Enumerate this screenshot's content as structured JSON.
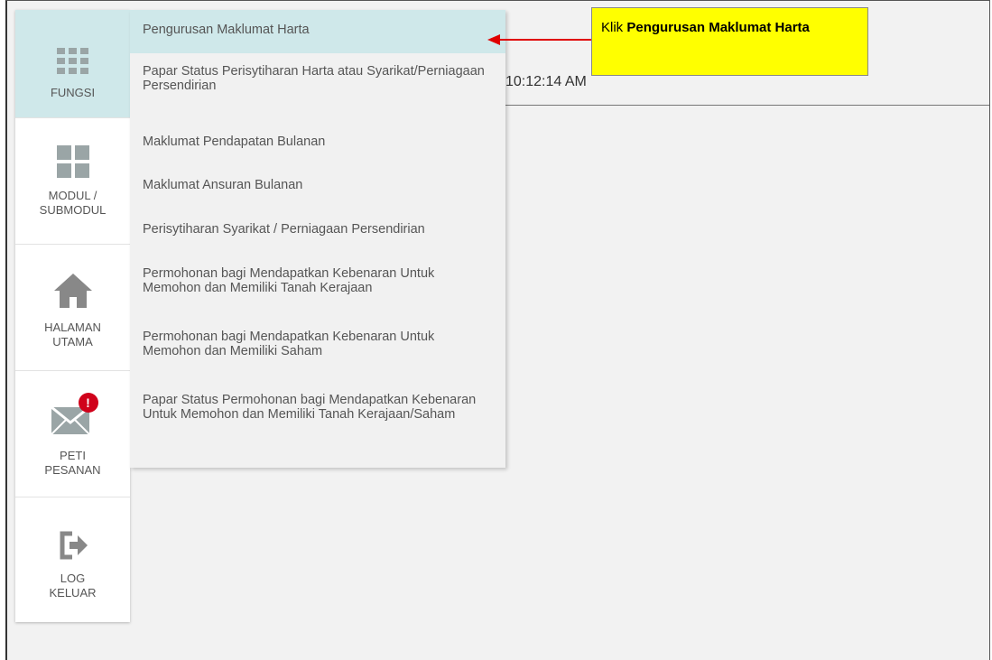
{
  "sidebar": {
    "items": [
      {
        "label": "FUNGSI",
        "icon": "grid-icon"
      },
      {
        "label": "MODUL /\nSUBMODUL",
        "icon": "modules-icon"
      },
      {
        "label": "HALAMAN\nUTAMA",
        "icon": "home-icon"
      },
      {
        "label": "PETI\nPESANAN",
        "icon": "mail-icon",
        "badge": "!"
      },
      {
        "label": "LOG\nKELUAR",
        "icon": "logout-icon"
      }
    ]
  },
  "menu": {
    "items": [
      "Pengurusan Maklumat Harta",
      "Papar Status Perisytiharan Harta atau Syarikat/Perniagaan Persendirian",
      "Maklumat Pendapatan Bulanan",
      "Maklumat Ansuran Bulanan",
      "Perisytiharan Syarikat / Perniagaan Persendirian",
      "Permohonan bagi Mendapatkan Kebenaran Untuk Memohon dan Memiliki Tanah Kerajaan",
      "Permohonan bagi Mendapatkan Kebenaran Untuk Memohon dan Memiliki Saham",
      "Papar Status Permohonan bagi Mendapatkan Kebenaran Untuk Memohon dan Memiliki Tanah Kerajaan/Saham"
    ]
  },
  "header": {
    "time": "10:12:14 AM"
  },
  "callout": {
    "prefix": "Klik ",
    "bold": "Pengurusan Maklumat Harta"
  },
  "colors": {
    "accent": "#cfe8ea",
    "callout": "#ffff00",
    "arrow": "#e00000",
    "badge": "#d0021b"
  }
}
